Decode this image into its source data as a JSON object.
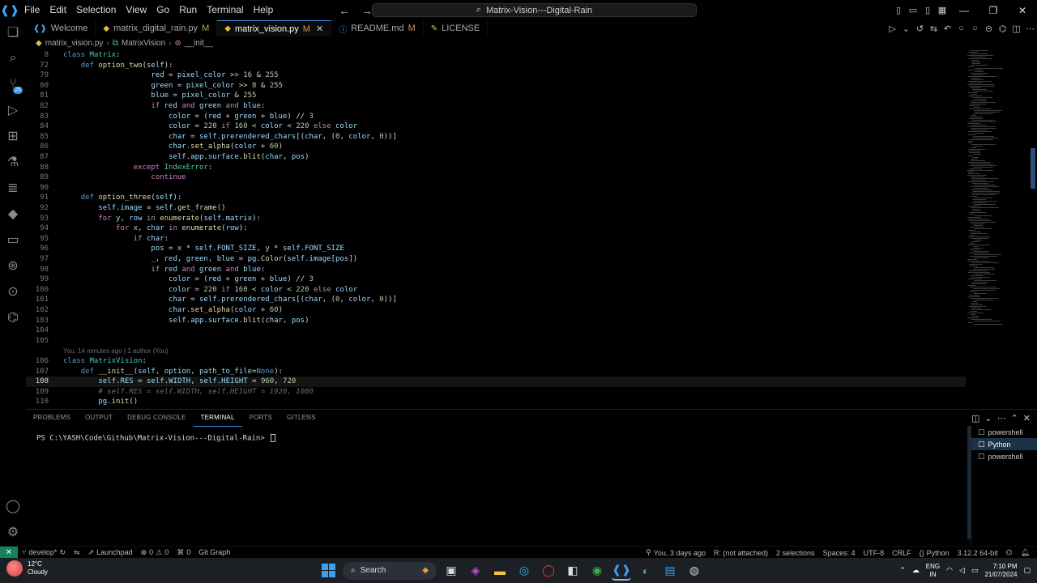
{
  "menu": [
    "File",
    "Edit",
    "Selection",
    "View",
    "Go",
    "Run",
    "Terminal",
    "Help"
  ],
  "command_center": "Matrix-Vision---Digital-Rain",
  "tabs": [
    {
      "label": "Welcome",
      "modified": "",
      "icon": "vscode-icon"
    },
    {
      "label": "matrix_digital_rain.py",
      "modified": "M",
      "icon": "python-icon"
    },
    {
      "label": "matrix_vision.py",
      "modified": "M",
      "icon": "python-icon",
      "active": true
    },
    {
      "label": "README.md",
      "modified": "M",
      "icon": "info-icon"
    },
    {
      "label": "LICENSE",
      "modified": "",
      "icon": "license-icon"
    }
  ],
  "breadcrumbs": [
    "matrix_vision.py",
    "MatrixVision",
    "__init__"
  ],
  "editor": {
    "sticky": [
      {
        "num": "8",
        "text": "class Matrix:"
      },
      {
        "num": "72",
        "text": "    def option_two(self):"
      }
    ],
    "lines": [
      {
        "num": "79",
        "text": "                    red = pixel_color >> 16 & 255"
      },
      {
        "num": "80",
        "text": "                    green = pixel_color >> 8 & 255"
      },
      {
        "num": "81",
        "text": "                    blue = pixel_color & 255"
      },
      {
        "num": "82",
        "text": "                    if red and green and blue:"
      },
      {
        "num": "83",
        "text": "                        color = (red + green + blue) // 3"
      },
      {
        "num": "84",
        "text": "                        color = 220 if 160 < color < 220 else color"
      },
      {
        "num": "85",
        "text": "                        char = self.prerendered_chars[(char, (0, color, 0))]"
      },
      {
        "num": "86",
        "text": "                        char.set_alpha(color + 60)"
      },
      {
        "num": "87",
        "text": "                        self.app.surface.blit(char, pos)"
      },
      {
        "num": "88",
        "text": "                except IndexError:"
      },
      {
        "num": "89",
        "text": "                    continue"
      },
      {
        "num": "90",
        "text": ""
      },
      {
        "num": "91",
        "text": "    def option_three(self):"
      },
      {
        "num": "92",
        "text": "        self.image = self.get_frame()"
      },
      {
        "num": "93",
        "text": "        for y, row in enumerate(self.matrix):"
      },
      {
        "num": "94",
        "text": "            for x, char in enumerate(row):"
      },
      {
        "num": "95",
        "text": "                if char:"
      },
      {
        "num": "96",
        "text": "                    pos = x * self.FONT_SIZE, y * self.FONT_SIZE"
      },
      {
        "num": "97",
        "text": "                    _, red, green, blue = pg.Color(self.image[pos])"
      },
      {
        "num": "98",
        "text": "                    if red and green and blue:"
      },
      {
        "num": "99",
        "text": "                        color = (red + green + blue) // 3"
      },
      {
        "num": "100",
        "text": "                        color = 220 if 160 < color < 220 else color"
      },
      {
        "num": "101",
        "text": "                        char = self.prerendered_chars[(char, (0, color, 0))]"
      },
      {
        "num": "102",
        "text": "                        char.set_alpha(color + 60)"
      },
      {
        "num": "103",
        "text": "                        self.app.surface.blit(char, pos)"
      },
      {
        "num": "104",
        "text": ""
      },
      {
        "num": "105",
        "text": ""
      },
      {
        "num": "106",
        "text": "class MatrixVision:"
      },
      {
        "num": "107",
        "text": "    def __init__(self, option, path_to_file=None):"
      },
      {
        "num": "108",
        "text": "        self.RES = self.WIDTH, self.HEIGHT = 960, 720"
      },
      {
        "num": "109",
        "text": "        # self.RES = self.WIDTH, self.HEIGHT = 1920, 1080"
      },
      {
        "num": "110",
        "text": "        pg.init()"
      }
    ],
    "codelens": "You, 14 minutes ago | 1 author (You)",
    "current_line": "108"
  },
  "panel": {
    "tabs": [
      "PROBLEMS",
      "OUTPUT",
      "DEBUG CONSOLE",
      "TERMINAL",
      "PORTS",
      "GITLENS"
    ],
    "active_tab": "TERMINAL",
    "prompt": "PS C:\\YASH\\Code\\Github\\Matrix-Vision---Digital-Rain> ",
    "terminals": [
      "powershell",
      "Python",
      "powershell"
    ],
    "selected_terminal": "Python"
  },
  "statusbar": {
    "branch": "develop*",
    "launchpad": "Launchpad",
    "errors": "0",
    "warnings": "0",
    "ports": "0",
    "git_graph": "Git Graph",
    "blame": "You, 3 days ago",
    "r_status": "R: (not attached)",
    "selections": "2 selections",
    "spaces": "Spaces: 4",
    "encoding": "UTF-8",
    "eol": "CRLF",
    "language": "Python",
    "interpreter": "3.12.2 64-bit"
  },
  "taskbar": {
    "temperature": "12°C",
    "weather": "Cloudy",
    "search": "Search",
    "language": "ENG",
    "region": "IN",
    "time": "7:10 PM",
    "date": "21/07/2024"
  }
}
